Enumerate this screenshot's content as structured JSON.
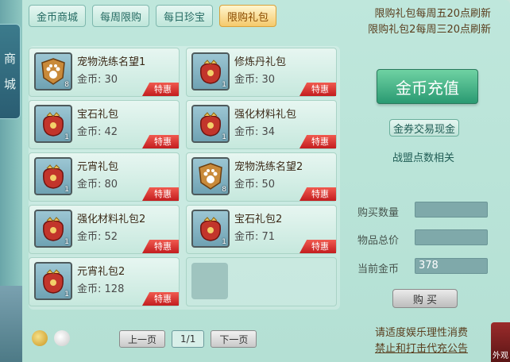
{
  "sidebar": {
    "title_1": "商",
    "title_2": "城"
  },
  "tabs": [
    {
      "label": "金币商城",
      "active": false
    },
    {
      "label": "每周限购",
      "active": false
    },
    {
      "label": "每日珍宝",
      "active": false
    },
    {
      "label": "限购礼包",
      "active": true
    }
  ],
  "notice": {
    "line1": "限购礼包每周五20点刷新",
    "line2": "限购礼包2每周三20点刷新"
  },
  "items": [
    {
      "name": "宠物洗练名望1",
      "price_label": "金币:",
      "price": "30",
      "qty": "8",
      "badge": "特惠",
      "icon": "paw-badge-icon"
    },
    {
      "name": "修炼丹礼包",
      "price_label": "金币:",
      "price": "30",
      "qty": "1",
      "badge": "特惠",
      "icon": "gift-bag-icon"
    },
    {
      "name": "宝石礼包",
      "price_label": "金币:",
      "price": "42",
      "qty": "1",
      "badge": "特惠",
      "icon": "gift-bag-icon"
    },
    {
      "name": "强化材料礼包",
      "price_label": "金币:",
      "price": "34",
      "qty": "1",
      "badge": "特惠",
      "icon": "gift-bag-icon"
    },
    {
      "name": "元宵礼包",
      "price_label": "金币:",
      "price": "80",
      "qty": "1",
      "badge": "特惠",
      "icon": "gift-bag-icon"
    },
    {
      "name": "宠物洗练名望2",
      "price_label": "金币:",
      "price": "50",
      "qty": "8",
      "badge": "特惠",
      "icon": "paw-badge-icon"
    },
    {
      "name": "强化材料礼包2",
      "price_label": "金币:",
      "price": "52",
      "qty": "1",
      "badge": "特惠",
      "icon": "gift-bag-icon"
    },
    {
      "name": "宝石礼包2",
      "price_label": "金币:",
      "price": "71",
      "qty": "1",
      "badge": "特惠",
      "icon": "gift-bag-icon"
    },
    {
      "name": "元宵礼包2",
      "price_label": "金币:",
      "price": "128",
      "qty": "1",
      "badge": "特惠",
      "icon": "gift-bag-icon"
    }
  ],
  "side": {
    "recharge": "金币充值",
    "exchange": "金券交易现金",
    "alliance": "战盟点数相关",
    "buy_qty_label": "购买数量",
    "total_label": "物品总价",
    "current_label": "当前金币",
    "current_value": "378",
    "buy_button": "购 买"
  },
  "pager": {
    "prev": "上一页",
    "page": "1/1",
    "next": "下一页"
  },
  "warning": {
    "line1": "请适度娱乐理性消费",
    "line2": "禁止和打击代充公告"
  },
  "corner": {
    "label": "外观"
  },
  "colors": {
    "tab_active": "#f5c96b",
    "badge": "#d4282a",
    "recharge": "#3aa97f"
  }
}
